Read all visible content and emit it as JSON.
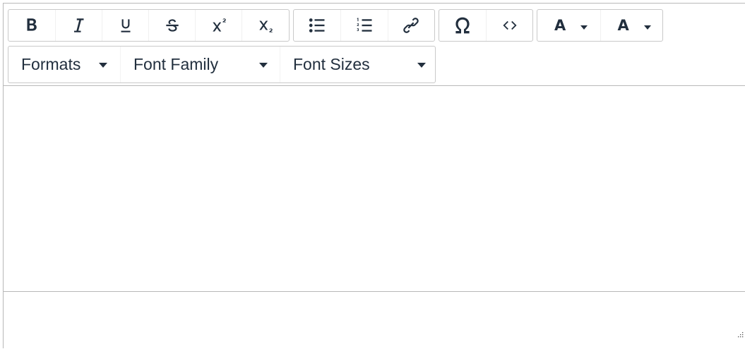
{
  "toolbar": {
    "row1": {
      "formatting": [
        {
          "name": "bold-icon",
          "title": "Bold"
        },
        {
          "name": "italic-icon",
          "title": "Italic"
        },
        {
          "name": "underline-icon",
          "title": "Underline"
        },
        {
          "name": "strikethrough-icon",
          "title": "Strikethrough"
        },
        {
          "name": "superscript-icon",
          "title": "Superscript"
        },
        {
          "name": "subscript-icon",
          "title": "Subscript"
        }
      ],
      "lists": [
        {
          "name": "bullet-list-icon",
          "title": "Bullet list"
        },
        {
          "name": "numbered-list-icon",
          "title": "Numbered list"
        },
        {
          "name": "link-icon",
          "title": "Insert/edit link"
        }
      ],
      "insert": [
        {
          "name": "special-character-icon",
          "title": "Special character"
        },
        {
          "name": "source-code-icon",
          "title": "Source code"
        }
      ],
      "colors": {
        "text_color_label": "A",
        "background_color_label": "A"
      }
    },
    "row2": {
      "formats_label": "Formats",
      "font_family_label": "Font Family",
      "font_sizes_label": "Font Sizes"
    }
  },
  "content": {
    "body_text": ""
  },
  "colors": {
    "icon": "#222f3e",
    "border": "#b8b8b8",
    "group_border": "#c9c9c9"
  }
}
